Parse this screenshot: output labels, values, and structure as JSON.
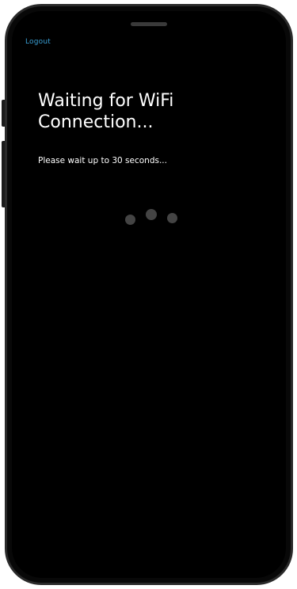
{
  "header": {
    "logout_label": "Logout"
  },
  "main": {
    "title": "Waiting for WiFi Connection...",
    "subtitle": "Please wait up to 30 seconds..."
  },
  "colors": {
    "screen_background": "#000000",
    "link": "#3aa0d6",
    "text": "#ffffff",
    "loader_dot": "#444444"
  },
  "icons": [
    "loading-dots-icon"
  ]
}
